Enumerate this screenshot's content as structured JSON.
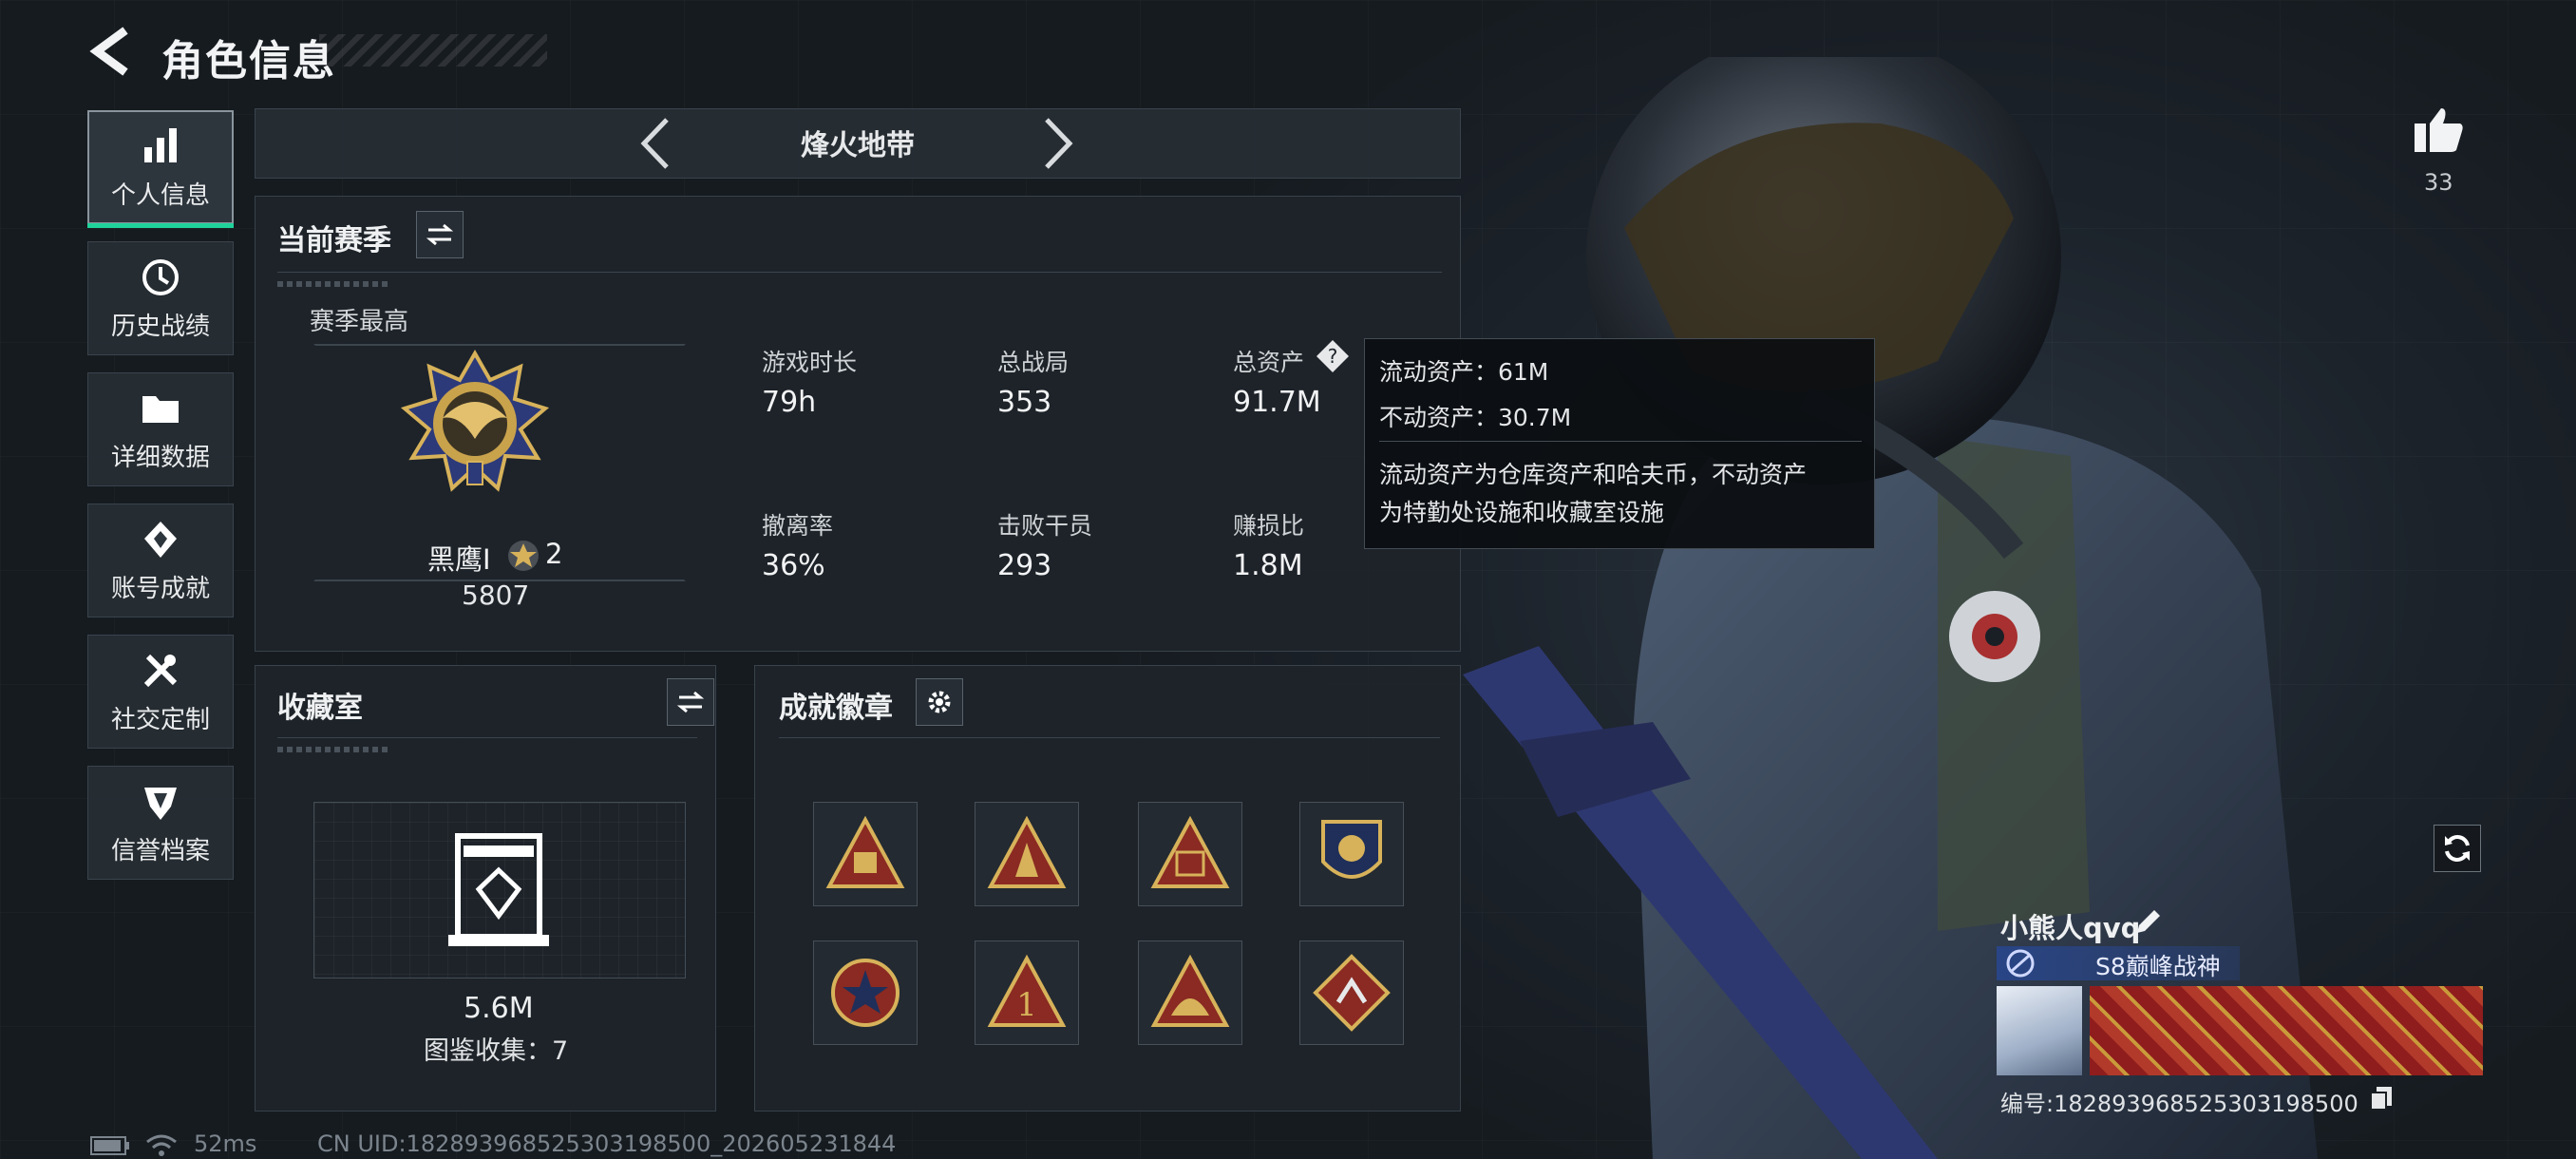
{
  "header": {
    "title": "角色信息"
  },
  "sidebar": {
    "items": [
      {
        "label": "个人信息",
        "icon": "bar-chart-icon"
      },
      {
        "label": "历史战绩",
        "icon": "history-icon"
      },
      {
        "label": "详细数据",
        "icon": "folder-icon"
      },
      {
        "label": "账号成就",
        "icon": "achievement-icon"
      },
      {
        "label": "社交定制",
        "icon": "tools-icon"
      },
      {
        "label": "信誉档案",
        "icon": "credit-icon"
      }
    ]
  },
  "mode_selector": {
    "title": "烽火地带"
  },
  "season": {
    "section_title": "当前赛季",
    "best_label": "赛季最高",
    "rank_name": "黑鹰Ⅰ",
    "rank_stars": "2",
    "rank_score": "5807",
    "stats": [
      {
        "label": "游戏时长",
        "value": "79h"
      },
      {
        "label": "总战局",
        "value": "353"
      },
      {
        "label": "总资产",
        "value": "91.7M"
      },
      {
        "label": "撤离率",
        "value": "36%"
      },
      {
        "label": "击败干员",
        "value": "293"
      },
      {
        "label": "赚损比",
        "value": "1.8M"
      }
    ]
  },
  "tooltip": {
    "liquid": "流动资产：61M",
    "fixed": "不动资产：30.7M",
    "desc_line1": "流动资产为仓库资产和哈夫币，不动资产",
    "desc_line2": "为特勤处设施和收藏室设施"
  },
  "collection": {
    "title": "收藏室",
    "value": "5.6M",
    "catalog": "图鉴收集：7"
  },
  "achievements": {
    "title": "成就徽章",
    "badges": [
      "badge-1",
      "badge-2",
      "badge-3",
      "badge-4",
      "badge-5",
      "badge-6",
      "badge-7",
      "badge-8"
    ]
  },
  "profile": {
    "likes": "33",
    "player_name": "小熊人qvq",
    "title_tag": "S8巅峰战神",
    "player_id": "编号:182893968525303198500"
  },
  "status": {
    "ping": "52ms",
    "uid": "CN UID:182893968525303198500_202605231844"
  },
  "colors": {
    "accent": "#1fd39a",
    "gold": "#d7b25a"
  }
}
